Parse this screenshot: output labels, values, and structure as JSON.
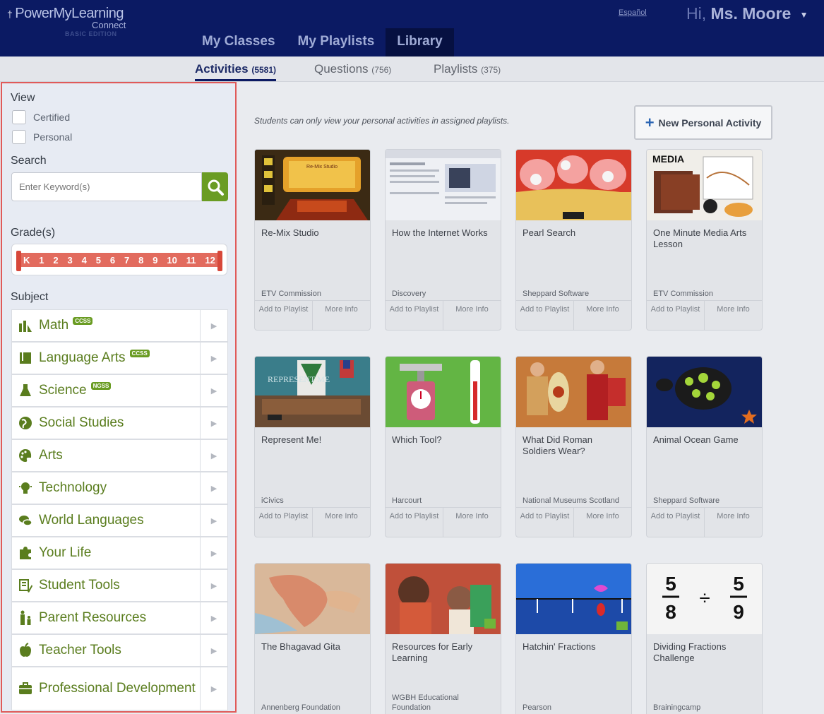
{
  "header": {
    "logo_line1": "PowerMyLearning",
    "logo_line2": "Connect",
    "logo_line3": "BASIC EDITION",
    "espanol": "Español",
    "greeting_prefix": "Hi,",
    "greeting_name": "Ms. Moore",
    "nav": [
      {
        "label": "My Classes"
      },
      {
        "label": "My Playlists"
      },
      {
        "label": "Library",
        "active": true
      }
    ]
  },
  "subtabs": [
    {
      "label": "Activities",
      "count": "(5581)",
      "active": true
    },
    {
      "label": "Questions",
      "count": "(756)"
    },
    {
      "label": "Playlists",
      "count": "(375)"
    }
  ],
  "sidebar": {
    "view_label": "View",
    "view_options": [
      "Certified",
      "Personal"
    ],
    "search_label": "Search",
    "search_placeholder": "Enter Keyword(s)",
    "grades_label": "Grade(s)",
    "grades": [
      "K",
      "1",
      "2",
      "3",
      "4",
      "5",
      "6",
      "7",
      "8",
      "9",
      "10",
      "11",
      "12"
    ],
    "subject_label": "Subject",
    "subjects": [
      {
        "name": "Math",
        "badge": "CCSS",
        "icon": "math-icon"
      },
      {
        "name": "Language Arts",
        "badge": "CCSS",
        "icon": "book-icon"
      },
      {
        "name": "Science",
        "badge": "NGSS",
        "icon": "flask-icon"
      },
      {
        "name": "Social Studies",
        "badge": "",
        "icon": "globe-icon"
      },
      {
        "name": "Arts",
        "badge": "",
        "icon": "palette-icon"
      },
      {
        "name": "Technology",
        "badge": "",
        "icon": "lightbulb-icon"
      },
      {
        "name": "World Languages",
        "badge": "",
        "icon": "speech-bubbles-icon"
      },
      {
        "name": "Your Life",
        "badge": "",
        "icon": "puzzle-icon"
      },
      {
        "name": "Student Tools",
        "badge": "",
        "icon": "tools-icon"
      },
      {
        "name": "Parent Resources",
        "badge": "",
        "icon": "family-icon"
      },
      {
        "name": "Teacher Tools",
        "badge": "",
        "icon": "apple-icon"
      },
      {
        "name": "Professional Development",
        "badge": "",
        "icon": "briefcase-icon"
      }
    ]
  },
  "content": {
    "notice": "Students can only view your personal activities in assigned playlists.",
    "new_activity_label": "New Personal Activity",
    "add_label": "Add to Playlist",
    "more_label": "More Info",
    "cards": [
      {
        "title": "Re-Mix Studio",
        "publisher": "ETV Commission",
        "thumb_color": "#1f1d22"
      },
      {
        "title": "How the Internet Works",
        "publisher": "Discovery",
        "thumb_color": "#eef0f4"
      },
      {
        "title": "Pearl Search",
        "publisher": "Sheppard Software",
        "thumb_color": "#e8c15a"
      },
      {
        "title": "One Minute Media Arts Lesson",
        "publisher": "ETV Commission",
        "thumb_color": "#f0eee9"
      },
      {
        "title": "Represent Me!",
        "publisher": "iCivics",
        "thumb_color": "#6b4b33"
      },
      {
        "title": "Which Tool?",
        "publisher": "Harcourt",
        "thumb_color": "#63b544"
      },
      {
        "title": "What Did Roman Soldiers Wear?",
        "publisher": "National Museums Scotland",
        "thumb_color": "#a04a2a"
      },
      {
        "title": "Animal Ocean Game",
        "publisher": "Sheppard Software",
        "thumb_color": "#13245e"
      },
      {
        "title": "The Bhagavad Gita",
        "publisher": "Annenberg Foundation",
        "thumb_color": "#c98d75"
      },
      {
        "title": "Resources for Early Learning",
        "publisher": "WGBH Educational Foundation",
        "thumb_color": "#d96a4a"
      },
      {
        "title": "Hatchin' Fractions",
        "publisher": "Pearson",
        "thumb_color": "#1d4aa8"
      },
      {
        "title": "Dividing Fractions Challenge",
        "publisher": "Brainingcamp",
        "thumb_color": "#f4f4f4"
      }
    ]
  },
  "colors": {
    "header_bg": "#0b1a63",
    "accent_green": "#6a9c23",
    "sidebar_border": "#e05a59",
    "grade_slider": "#e26b5e"
  },
  "thumb_texts": {
    "remix": "Re-Mix Studio",
    "media": "MEDIA",
    "represent": "REPRESENT ME",
    "frac_a_num": "5",
    "frac_a_den": "8",
    "frac_op": "÷",
    "frac_b_num": "5",
    "frac_b_den": "9"
  }
}
